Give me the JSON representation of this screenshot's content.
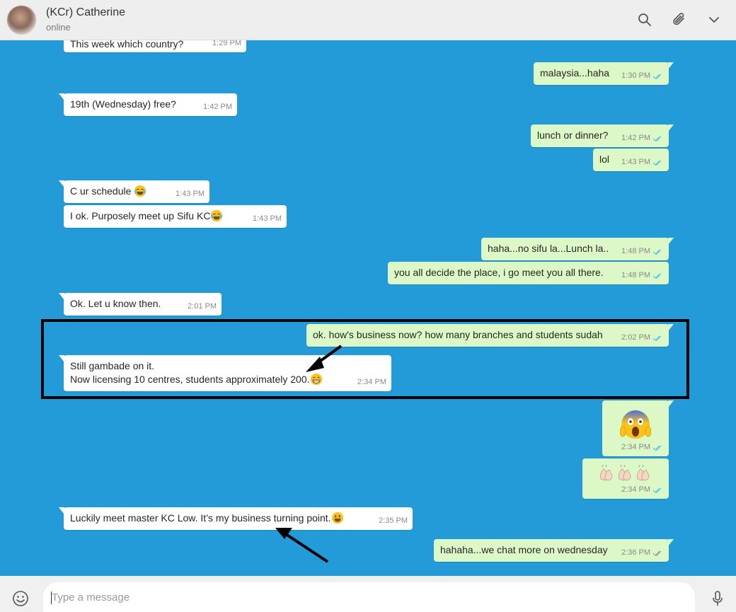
{
  "header": {
    "contact_name": "(KCr) Catherine",
    "status": "online"
  },
  "colors": {
    "chat_background": "#229bd8",
    "incoming_bubble": "#ffffff",
    "outgoing_bubble": "#dcf8c6",
    "read_ticks": "#4fc3f7",
    "highlight_border": "#000000"
  },
  "messages": [
    {
      "dir": "in",
      "text": "This week which country?",
      "time": "1:29 PM"
    },
    {
      "dir": "out",
      "text": "malaysia...haha",
      "time": "1:30 PM"
    },
    {
      "dir": "in",
      "text": "19th (Wednesday) free?",
      "time": "1:42 PM"
    },
    {
      "dir": "out",
      "text": "lunch or dinner?",
      "time": "1:42 PM"
    },
    {
      "dir": "out",
      "text": "lol",
      "time": "1:43 PM"
    },
    {
      "dir": "in",
      "text": "C ur schedule ",
      "emoji": "tears-of-joy",
      "time": "1:43 PM"
    },
    {
      "dir": "in",
      "text": "I ok. Purposely meet up Sifu KC",
      "emoji": "tears-of-joy",
      "time": "1:43 PM"
    },
    {
      "dir": "out",
      "text": "haha...no sifu la...Lunch la..",
      "time": "1:48 PM"
    },
    {
      "dir": "out",
      "text": "you all decide the place, i go meet you all there.",
      "time": "1:48 PM"
    },
    {
      "dir": "in",
      "text": "Ok. Let u know then.",
      "time": "2:01 PM"
    },
    {
      "dir": "out",
      "text": "ok. how's business now? how many branches and students sudah",
      "time": "2:02 PM"
    },
    {
      "dir": "in",
      "text": "Still gambade on it.\nNow licensing 10 centres, students approximately 200.",
      "emoji": "grinning",
      "time": "2:34 PM"
    },
    {
      "dir": "out",
      "text": "",
      "emoji": "screaming-in-fear",
      "time": "2:34 PM"
    },
    {
      "dir": "out",
      "text": "",
      "emoji": "clapping-hands-x3",
      "time": "2:34 PM"
    },
    {
      "dir": "in",
      "text": "Luckily meet master KC Low. It’s my business turning point.",
      "emoji": "smiley",
      "time": "2:35 PM"
    },
    {
      "dir": "out",
      "text": "hahaha...we chat more on wednesday",
      "time": "2:36 PM"
    }
  ],
  "footer": {
    "placeholder": "Type a message",
    "emoji_icon": "smiley-face-icon",
    "mic_icon": "microphone-icon"
  },
  "header_icons": [
    "search-icon",
    "paperclip-icon",
    "chevron-down-icon"
  ]
}
